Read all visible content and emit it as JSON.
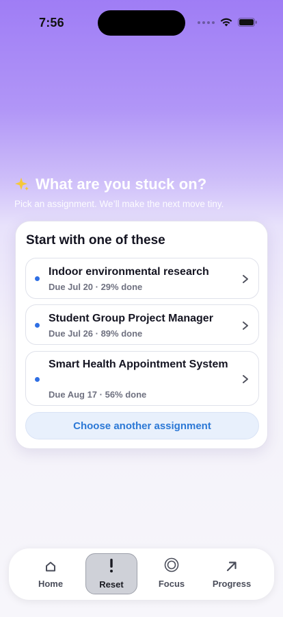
{
  "status_bar": {
    "time": "7:56"
  },
  "header": {
    "title": "What are you stuck on?",
    "subtitle": "Pick an assignment. We’ll make the next move tiny."
  },
  "card": {
    "title": "Start with one of these",
    "assignments": [
      {
        "name": "Indoor environmental research",
        "meta": "Due Jul 20 · 29% done"
      },
      {
        "name": "Student Group Project Manager",
        "meta": "Due Jul 26 · 89% done"
      },
      {
        "name": "Smart Health Appointment System",
        "meta": "Due Aug 17 · 56% done"
      }
    ],
    "choose_label": "Choose another assignment"
  },
  "tabs": [
    {
      "label": "Home",
      "icon": "home-icon",
      "active": false
    },
    {
      "label": "Reset",
      "icon": "exclamation-icon",
      "active": true
    },
    {
      "label": "Focus",
      "icon": "target-icon",
      "active": false
    },
    {
      "label": "Progress",
      "icon": "arrow-up-right-icon",
      "active": false
    }
  ],
  "colors": {
    "accent": "#2b78d6",
    "dot": "#2f6fe4",
    "title": "#141421",
    "gradient_top": "#9f7df5"
  }
}
